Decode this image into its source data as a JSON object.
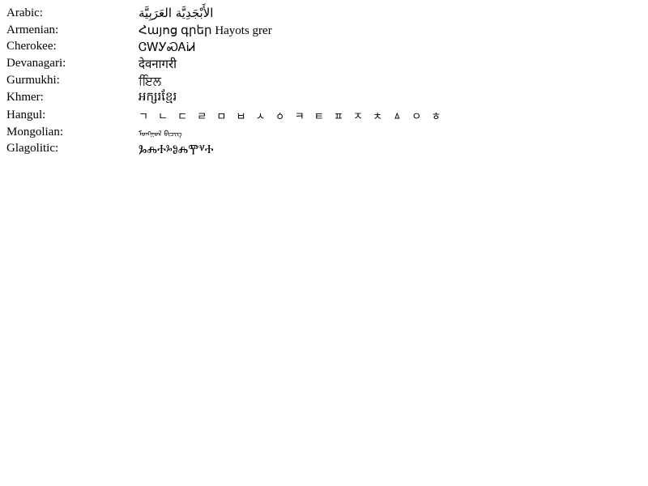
{
  "rows": [
    {
      "label": "Arabic:",
      "sample": "الأَبْجَدِيَّة العَرَبِيَّة"
    },
    {
      "label": "Armenian:",
      "sample": "Հայոց գրեր Hayots grer"
    },
    {
      "label": "Cherokee:",
      "sample": "ᏣᎳᎩᏍᎪᎥᏗ"
    },
    {
      "label": "Devanagari:",
      "sample": "देवनागरी"
    },
    {
      "label": "Gurmukhi:",
      "sample": "ਇਿਲ"
    },
    {
      "label": "Khmer:",
      "sample": "អក្សរខ្មែរ"
    },
    {
      "label": "Hangul:",
      "sample": "ㄱ ㄴ ㄷ ㄹ ㅁ ㅂ ㅅ ㆁ ㅋ ㅌ ㅍ ㅈ ㅊ ㅿ ㅇ ㅎ"
    },
    {
      "label": "Mongolian:",
      "sample": "ᠮᠣᠩᠭᠣᠯ ᠪᠢᠴᠢᠭ"
    },
    {
      "label": "Glagolitic:",
      "sample": "ⰃⰎⰀⰳⰑⰎⰉⱌⰀ"
    }
  ]
}
